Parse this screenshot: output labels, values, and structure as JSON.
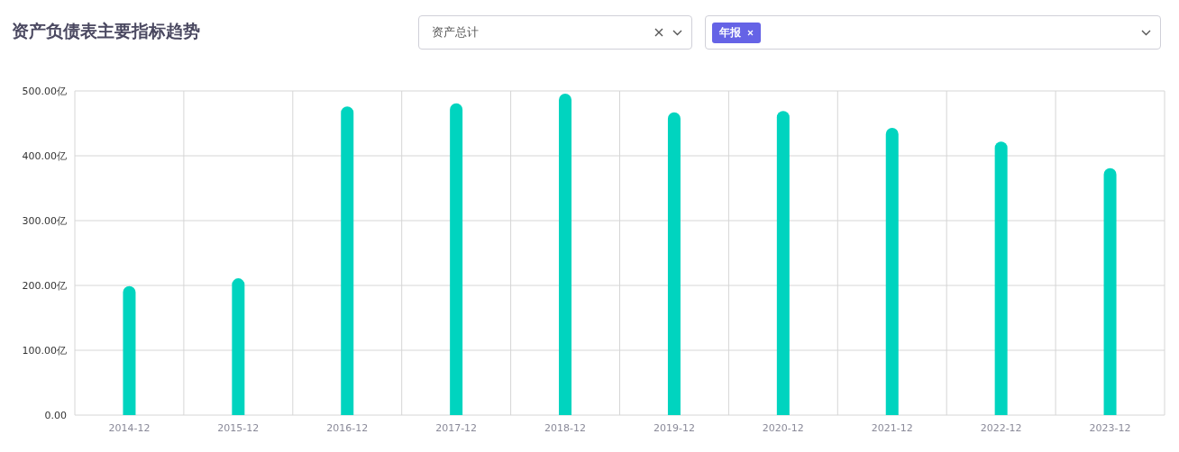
{
  "title": "资产负债表主要指标趋势",
  "indicator_select": {
    "value": "资产总计"
  },
  "period_select": {
    "tags": [
      "年报"
    ]
  },
  "chart": {
    "chart_data": {
      "type": "bar",
      "categories": [
        "2014-12",
        "2015-12",
        "2016-12",
        "2017-12",
        "2018-12",
        "2019-12",
        "2020-12",
        "2021-12",
        "2022-12",
        "2023-12"
      ],
      "grid": true,
      "series": [
        {
          "color": "#00d4bf",
          "values": [
            199,
            211,
            476,
            481,
            496,
            467,
            469,
            443,
            422,
            381
          ]
        }
      ],
      "ylim": [
        0,
        500
      ],
      "yticks": [
        {
          "value": 0,
          "label": "0.00"
        },
        {
          "value": 100,
          "label": "100.00亿"
        },
        {
          "value": 200,
          "label": "200.00亿"
        },
        {
          "value": 300,
          "label": "300.00亿"
        },
        {
          "value": 400,
          "label": "400.00亿"
        },
        {
          "value": 500,
          "label": "500.00亿"
        }
      ]
    }
  }
}
